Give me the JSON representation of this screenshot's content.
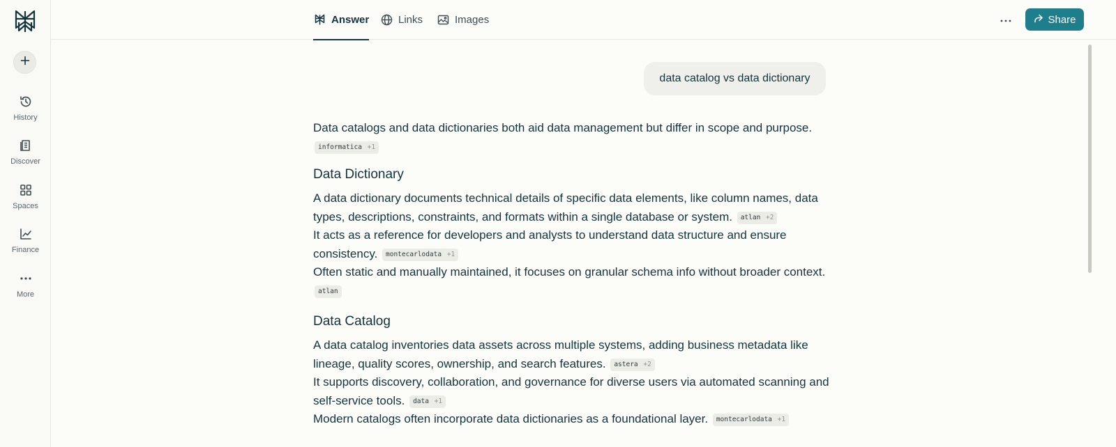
{
  "sidebar": {
    "new_thread_icon": "plus-icon",
    "items": [
      {
        "label": "History",
        "icon": "history-icon"
      },
      {
        "label": "Discover",
        "icon": "discover-icon"
      },
      {
        "label": "Spaces",
        "icon": "grid-icon"
      },
      {
        "label": "Finance",
        "icon": "chart-icon"
      },
      {
        "label": "More",
        "icon": "more-icon"
      }
    ]
  },
  "header": {
    "tabs": [
      {
        "label": "Answer",
        "icon": "perplexity-icon",
        "active": true
      },
      {
        "label": "Links",
        "icon": "globe-icon",
        "active": false
      },
      {
        "label": "Images",
        "icon": "image-icon",
        "active": false
      }
    ],
    "share_label": "Share",
    "accent_color": "#1f7e8b"
  },
  "query": "data catalog vs data dictionary",
  "answer": {
    "intro": "Data catalogs and data dictionaries both aid data management but differ in scope and purpose.",
    "intro_cite": {
      "source": "informatica",
      "extra": "+1"
    },
    "sections": [
      {
        "heading": "Data Dictionary",
        "sentences": [
          {
            "text": "A data dictionary documents technical details of specific data elements, like column names, data types, descriptions, constraints, and formats within a single database or system.",
            "source": "atlan",
            "extra": "+2"
          },
          {
            "text": "It acts as a reference for developers and analysts to understand data structure and ensure consistency.",
            "source": "montecarlodata",
            "extra": "+1"
          },
          {
            "text": "Often static and manually maintained, it focuses on granular schema info without broader context.",
            "source": "atlan",
            "extra": ""
          }
        ]
      },
      {
        "heading": "Data Catalog",
        "sentences": [
          {
            "text": "A data catalog inventories data assets across multiple systems, adding business metadata like lineage, quality scores, ownership, and search features.",
            "source": "astera",
            "extra": "+2"
          },
          {
            "text": "It supports discovery, collaboration, and governance for diverse users via automated scanning and self-service tools.",
            "source": "data",
            "extra": "+1"
          },
          {
            "text": "Modern catalogs often incorporate data dictionaries as a foundational layer.",
            "source": "montecarlodata",
            "extra": "+1"
          }
        ]
      }
    ]
  }
}
